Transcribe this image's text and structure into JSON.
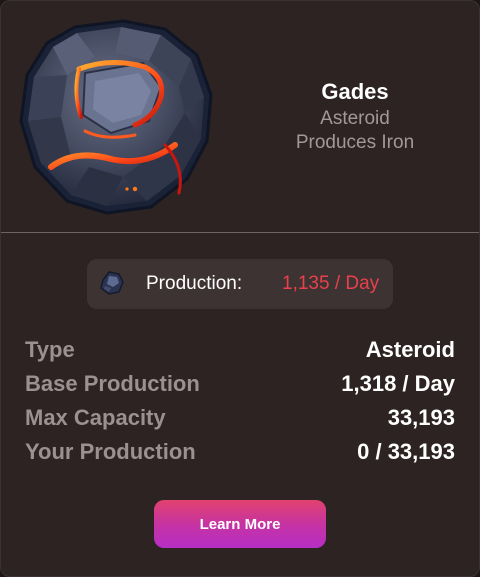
{
  "asset": {
    "icon": "asteroid-iron-ore",
    "name": "Gades",
    "category": "Asteroid",
    "produces": "Produces Iron"
  },
  "production": {
    "icon": "iron-ore-icon",
    "label": "Production:",
    "value": "1,135 / Day",
    "value_color": "#e8404c"
  },
  "stats": [
    {
      "key": "Type",
      "value": "Asteroid"
    },
    {
      "key": "Base Production",
      "value": "1,318 / Day"
    },
    {
      "key": "Max Capacity",
      "value": "33,193"
    },
    {
      "key": "Your Production",
      "value": "0 / 33,193"
    }
  ],
  "actions": {
    "learn_more": "Learn More"
  },
  "colors": {
    "background": "#2c2322",
    "accent_gradient_start": "#e2426e",
    "accent_gradient_end": "#b62fc4"
  }
}
